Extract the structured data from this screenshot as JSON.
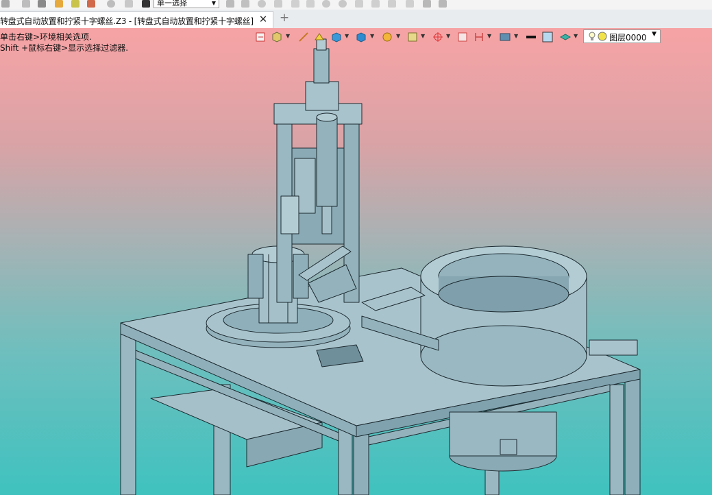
{
  "toolbar": {
    "selection_mode": "单一选择",
    "icons": [
      "filter-icon",
      "pointer-icon",
      "list-icon",
      "folder-icon",
      "open-icon",
      "pick-icon",
      "history-icon",
      "pin-icon",
      "stop-icon",
      "select-icon",
      "arrow-icon",
      "snap-icon",
      "play-icon",
      "grid-icon",
      "line-icon",
      "arc-icon",
      "circle-icon",
      "curve-icon",
      "wave-icon",
      "spline-icon",
      "pen-icon",
      "shape-icon",
      "cube-icon"
    ]
  },
  "tab": {
    "title": "转盘式自动放置和拧紧十字螺丝.Z3 - [转盘式自动放置和拧紧十字螺丝]",
    "close_symbol": "✕",
    "add_symbol": "+"
  },
  "viewport": {
    "hints": [
      "单击右键>环境相关选项.",
      "Shift +鼠标右键>显示选择过滤器."
    ],
    "view_toolbar": {
      "layer_label": "图层0000",
      "dropdown_symbol": "▼",
      "colors": {
        "line_color": "#111111",
        "fill_color": "#b7d9f0"
      },
      "icons": [
        "exit-sketch-icon",
        "view-filter-icon",
        "measure-icon",
        "highlight-icon",
        "shading-icon",
        "display-icon",
        "section-icon",
        "render-icon",
        "snap-icon",
        "frame-icon",
        "dimension-icon",
        "view-icon",
        "line-color-icon",
        "fill-color-icon",
        "layers-icon",
        "light-icon"
      ]
    },
    "background": {
      "top": "#f7a3a5",
      "bottom": "#3fc2bf"
    },
    "model": {
      "color": "#8fb0bd",
      "edge": "#1c2a30"
    }
  }
}
